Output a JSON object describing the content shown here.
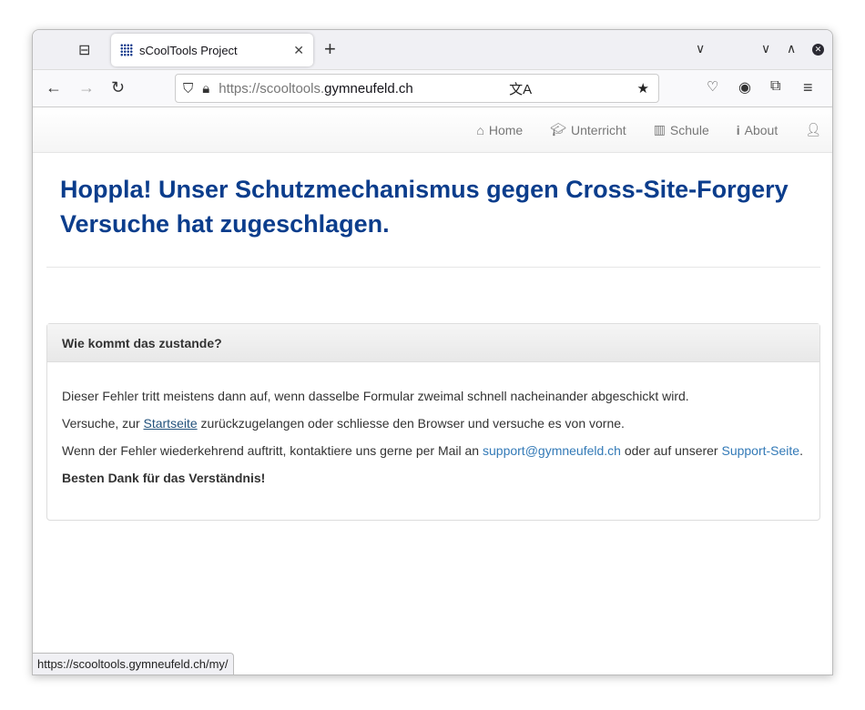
{
  "browser": {
    "tab_title": "sCoolTools Project",
    "url_prefix": "https://scooltools.",
    "url_domain": "gymneufeld.ch",
    "status_url": "https://scooltools.gymneufeld.ch/my/"
  },
  "nav": {
    "items": [
      {
        "label": "Home",
        "icon": "home-icon"
      },
      {
        "label": "Unterricht",
        "icon": "graduation-cap-icon"
      },
      {
        "label": "Schule",
        "icon": "school-icon"
      },
      {
        "label": "About",
        "icon": "info-icon"
      }
    ]
  },
  "main": {
    "title": "Hoppla! Unser Schutzmechanismus gegen Cross-Site-Forgery Versuche hat zugeschlagen.",
    "panel": {
      "heading": "Wie kommt das zustande?",
      "p1": "Dieser Fehler tritt meistens dann auf, wenn dasselbe Formular zweimal schnell nacheinander abgeschickt wird.",
      "p2a": "Versuche, zur ",
      "p2link": "Startseite",
      "p2b": " zurückzugelangen oder schliesse den Browser und versuche es von vorne.",
      "p3a": "Wenn der Fehler wiederkehrend auftritt, kontaktiere uns gerne per Mail an ",
      "p3mail": "support@gymneufeld.ch",
      "p3b": " oder auf unserer ",
      "p3link": "Support-Seite",
      "p3c": ".",
      "p4": "Besten Dank für das Verständnis!"
    }
  }
}
